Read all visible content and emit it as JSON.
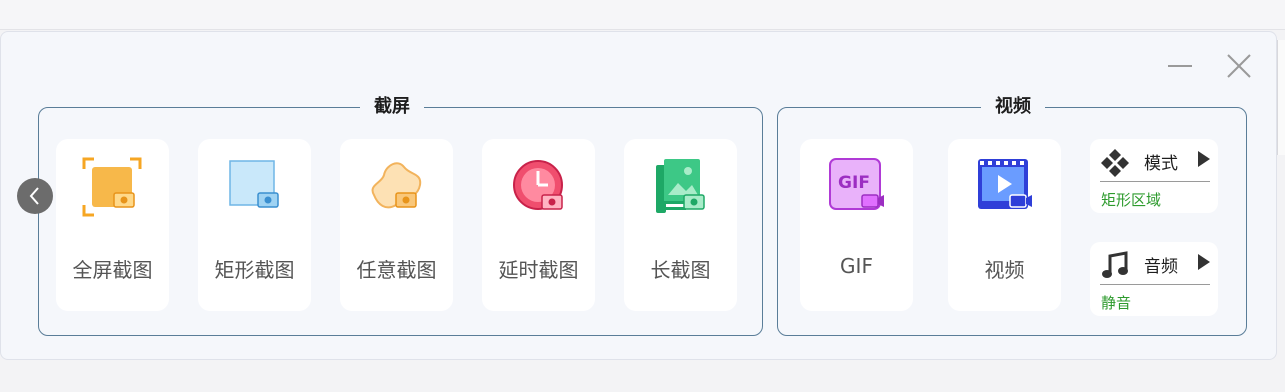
{
  "screenshot_section": {
    "title": "截屏",
    "items": [
      {
        "label": "全屏截图",
        "icon": "fullscreen-capture-icon"
      },
      {
        "label": "矩形截图",
        "icon": "rectangle-capture-icon"
      },
      {
        "label": "任意截图",
        "icon": "freeform-capture-icon"
      },
      {
        "label": "延时截图",
        "icon": "delayed-capture-icon"
      },
      {
        "label": "长截图",
        "icon": "long-capture-icon"
      }
    ]
  },
  "video_section": {
    "title": "视频",
    "items": [
      {
        "label": "GIF",
        "icon_text": "GIF",
        "icon": "gif-record-icon"
      },
      {
        "label": "视频",
        "icon": "video-record-icon"
      }
    ],
    "mode": {
      "label": "模式",
      "value": "矩形区域",
      "icon": "diamond-mode-icon"
    },
    "audio": {
      "label": "音频",
      "value": "静音",
      "icon": "music-note-icon"
    }
  },
  "colors": {
    "group_border": "#5a7d98",
    "accent_green": "#2e9b2e",
    "orange": "#f6a623",
    "light_blue": "#bfe3f7",
    "red": "#e63a5c",
    "green": "#22b673",
    "purple": "#b03ad6"
  }
}
